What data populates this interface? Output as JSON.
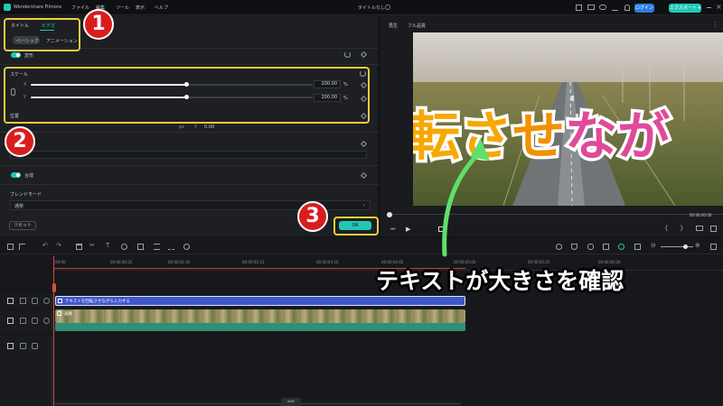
{
  "app": {
    "name": "Wondershare Filmora",
    "menu": [
      "ファイル",
      "編集",
      "ツール",
      "表示",
      "ヘルプ"
    ],
    "project_title": "タイトルなし",
    "login_label": "ログイン",
    "export_label": "エクスポート ▾"
  },
  "panel": {
    "tabs": [
      "タイトル",
      "ビデオ"
    ],
    "subtabs": [
      "ベーシック",
      "アニメーション"
    ],
    "transform_label": "変形",
    "scale_label": "スケール",
    "x_label": "X",
    "y_label": "Y",
    "scale_x_value": "200.00",
    "scale_y_value": "200.00",
    "percent": "%",
    "scale_fraction": 0.55,
    "position_label": "位置",
    "px_label": "px",
    "pos_y_label": "Y",
    "pos_y_value": "0.00",
    "composite_label": "合成",
    "blend_mode_label": "ブレンドモード",
    "blend_mode_value": "通常",
    "reset_label": "リセット",
    "ok_label": "OK"
  },
  "preview": {
    "mode_label": "再生",
    "quality_label": "フル品質",
    "overlay_text": "転させなが",
    "timecode": "00:00:00:00"
  },
  "timeline": {
    "ruler_ticks": [
      "00:00",
      "00:00:00:25",
      "00:00:01:20",
      "00:00:02:15",
      "00:00:03:10",
      "00:00:04:05",
      "00:00:05:00",
      "00:00:05:25",
      "00:00:06:20"
    ],
    "title_clip_label": "テキストを回転させながら入力する",
    "video_clip_label": "道路",
    "bottom_label": "検索"
  },
  "annotations": {
    "badges": [
      "1",
      "2",
      "3"
    ],
    "caption": "テキストが大きさを確認"
  },
  "colors": {
    "accent": "#21c8b5",
    "highlight": "#f2cc3d",
    "badge": "#d91d1d",
    "title_clip": "#3f57c9",
    "audio_clip": "#2f8f78",
    "arrow": "#5fe06a"
  }
}
